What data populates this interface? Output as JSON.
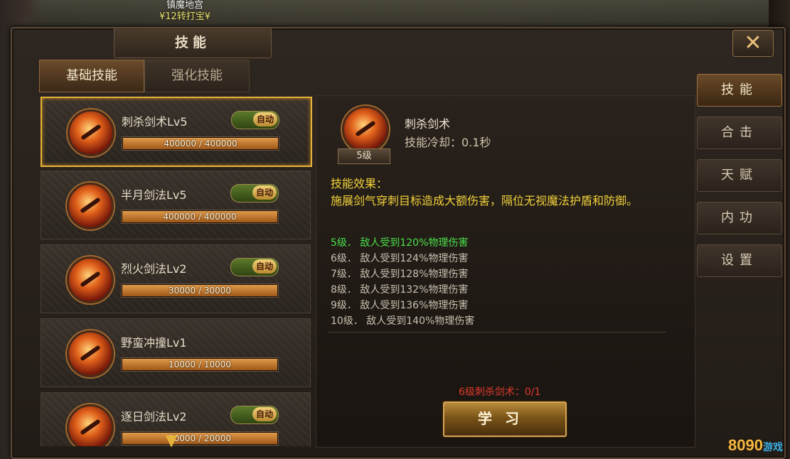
{
  "background": {
    "top_name": "镇魔地宫",
    "top_subtitle": "¥12转打宝¥",
    "watermark_main": "8090",
    "watermark_sub": "游戏"
  },
  "window": {
    "title": "技能",
    "close_icon": "close-x-icon"
  },
  "tabs": [
    {
      "label": "基础技能",
      "active": true
    },
    {
      "label": "强化技能",
      "active": false
    }
  ],
  "skills": [
    {
      "name": "刺杀剑术Lv5",
      "exp": "400000 / 400000",
      "progress": 1.0,
      "auto": true,
      "auto_label": "自动",
      "selected": true
    },
    {
      "name": "半月剑法Lv5",
      "exp": "400000 / 400000",
      "progress": 1.0,
      "auto": true,
      "auto_label": "自动",
      "selected": false
    },
    {
      "name": "烈火剑法Lv2",
      "exp": "30000 / 30000",
      "progress": 1.0,
      "auto": true,
      "auto_label": "自动",
      "selected": false
    },
    {
      "name": "野蛮冲撞Lv1",
      "exp": "10000 / 10000",
      "progress": 1.0,
      "auto": false,
      "auto_label": "",
      "selected": false
    },
    {
      "name": "逐日剑法Lv2",
      "exp": "20000 / 20000",
      "progress": 1.0,
      "auto": true,
      "auto_label": "自动",
      "selected": false
    }
  ],
  "detail": {
    "name": "刺杀剑术",
    "cooldown": "技能冷却：0.1秒",
    "level_badge": "5级",
    "effect_title": "技能效果：",
    "effect_desc": "施展剑气穿刺目标造成大额伤害，隔位无视魔法护盾和防御。",
    "levels": [
      {
        "text": "5级． 敌人受到120%物理伤害",
        "current": true
      },
      {
        "text": "6级． 敌人受到124%物理伤害",
        "current": false
      },
      {
        "text": "7级． 敌人受到128%物理伤害",
        "current": false
      },
      {
        "text": "8级． 敌人受到132%物理伤害",
        "current": false
      },
      {
        "text": "9级． 敌人受到136%物理伤害",
        "current": false
      },
      {
        "text": "10级． 敌人受到140%物理伤害",
        "current": false
      }
    ],
    "requirement": "6级刺杀剑术：0/1",
    "learn_label": "学习"
  },
  "side_tabs": [
    {
      "label": "技能",
      "active": true
    },
    {
      "label": "合击",
      "active": false
    },
    {
      "label": "天赋",
      "active": false
    },
    {
      "label": "内功",
      "active": false
    },
    {
      "label": "设置",
      "active": false
    }
  ]
}
